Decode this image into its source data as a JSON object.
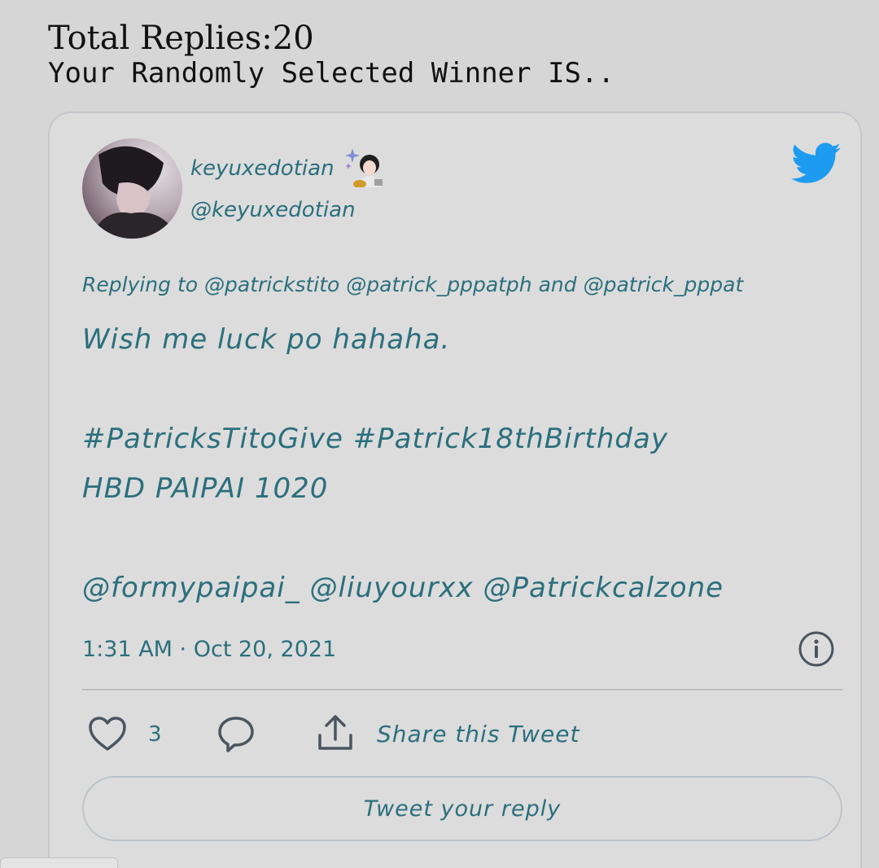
{
  "header": {
    "total_replies": "Total Replies:20",
    "winner_text": "Your Randomly Selected Winner IS.."
  },
  "tweet": {
    "display_name": "keyuxedotian",
    "handle": "@keyuxedotian",
    "replying_to": "Replying to @patrickstito @patrick_pppatph and @patrick_pppat",
    "text_lines": [
      "Wish me luck po hahaha.",
      "#PatricksTitoGive #Patrick18thBirthday",
      "HBD PAIPAI 1020",
      "@formypaipai_ @liuyourxx @Patrickcalzone"
    ],
    "timestamp": "1:31 AM · Oct 20, 2021",
    "like_count": "3",
    "share_label": "Share this Tweet",
    "reply_button_label": "Tweet your reply"
  },
  "icons": {
    "brand": "twitter-bird-icon",
    "info": "info-icon",
    "like": "heart-icon",
    "reply": "speech-bubble-icon",
    "share": "share-upload-icon",
    "emoji": "sparkles-woman-emoji"
  },
  "colors": {
    "text_accent": "#2b6f7d",
    "twitter_blue": "#1d9bf0",
    "background": "#d6d6d6",
    "card_border": "#c4c7cb"
  }
}
